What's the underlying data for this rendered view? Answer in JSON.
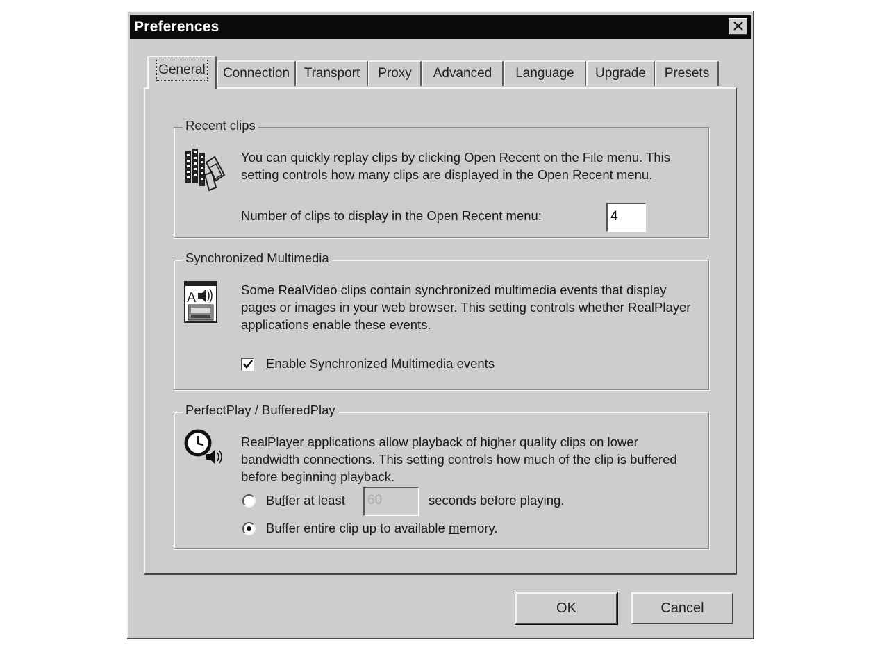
{
  "window": {
    "title": "Preferences"
  },
  "tabs": [
    "General",
    "Connection",
    "Transport",
    "Proxy",
    "Advanced",
    "Language",
    "Upgrade",
    "Presets"
  ],
  "recent_clips": {
    "legend": "Recent clips",
    "description": "You can quickly replay clips by clicking Open Recent on the File menu. This setting controls how many clips are displayed in the Open Recent menu.",
    "label_access": "N",
    "label_rest": "umber of clips to display in the Open Recent menu:",
    "count_value": "4",
    "icon": "film-stack-icon"
  },
  "sync_multimedia": {
    "legend": "Synchronized Multimedia",
    "description": "Some RealVideo clips contain synchronized multimedia events that display pages or images in your web browser. This setting controls whether RealPlayer applications enable these events.",
    "checkbox_access": "E",
    "checkbox_rest": "nable Synchronized Multimedia events",
    "checked": true,
    "icon": "multimedia-icon"
  },
  "perfectplay": {
    "legend": "PerfectPlay / BufferedPlay",
    "description": "RealPlayer applications allow playback of higher quality clips on lower bandwidth connections. This setting controls how much of the clip is buffered before beginning playback.",
    "radio1_pre": "Bu",
    "radio1_access": "f",
    "radio1_post": "fer at least",
    "seconds_value": "60",
    "seconds_suffix": "seconds before playing.",
    "radio2_pre": "Buffer entire clip up to available ",
    "radio2_access": "m",
    "radio2_post": "emory.",
    "selected": "entire",
    "icon": "clock-speaker-icon"
  },
  "buttons": {
    "ok": "OK",
    "cancel": "Cancel"
  }
}
